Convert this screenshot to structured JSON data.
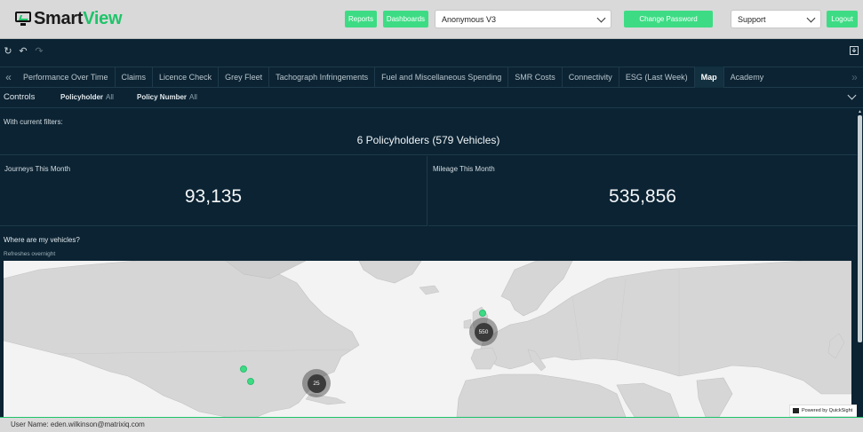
{
  "header": {
    "logo_primary": "Smart",
    "logo_accent": "View",
    "reports_label": "Reports",
    "dashboards_label": "Dashboards",
    "account_select_value": "Anonymous V3",
    "change_password_label": "Change Password",
    "support_select_value": "Support",
    "logout_label": "Logout"
  },
  "toolbar": {
    "icons": [
      "refresh-icon",
      "undo-icon",
      "redo-icon",
      "download-icon"
    ]
  },
  "tabs": [
    {
      "label": "Performance Over Time"
    },
    {
      "label": "Claims"
    },
    {
      "label": "Licence Check"
    },
    {
      "label": "Grey Fleet"
    },
    {
      "label": "Tachograph Infringements"
    },
    {
      "label": "Fuel and Miscellaneous Spending"
    },
    {
      "label": "SMR Costs"
    },
    {
      "label": "Connectivity"
    },
    {
      "label": "ESG (Last Week)"
    },
    {
      "label": "Map",
      "active": true
    },
    {
      "label": "Academy"
    }
  ],
  "controls": {
    "title": "Controls",
    "policyholder_label": "Policyholder",
    "policyholder_value": "All",
    "policy_number_label": "Policy Number",
    "policy_number_value": "All"
  },
  "summary": {
    "title": "With current filters:",
    "text": "6 Policyholders (579 Vehicles)"
  },
  "kpis": {
    "journeys_title": "Journeys This Month",
    "journeys_value": "93,135",
    "mileage_title": "Mileage This Month",
    "mileage_value": "535,856"
  },
  "map": {
    "title": "Where are my vehicles?",
    "subtitle": "Refreshes overnight",
    "cluster_europe": "550",
    "cluster_americas": "25",
    "powered_by": "Powered by QuickSight"
  },
  "colors": {
    "accent": "#3ddc84",
    "background": "#0b2333"
  },
  "status": {
    "user": "User Name: eden.wilkinson@matrixiq.com"
  }
}
